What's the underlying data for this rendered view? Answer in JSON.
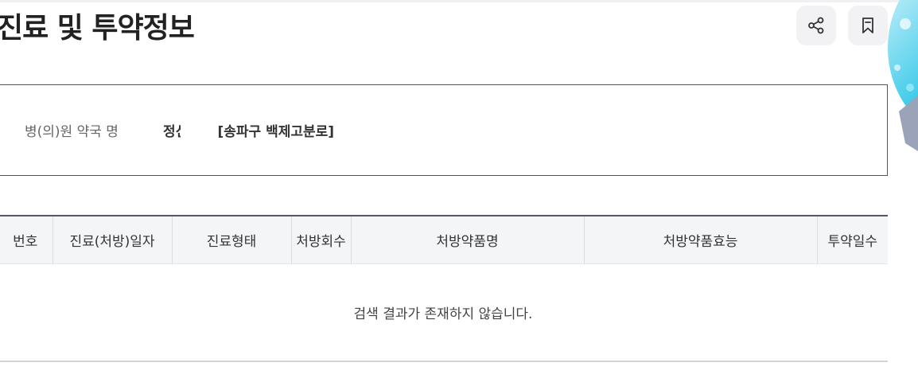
{
  "header": {
    "title": "진료 및 투약정보",
    "share_icon": "share-icon",
    "bookmark_icon": "bookmark-icon"
  },
  "pharmacy": {
    "label": "병(의)원 약국 명",
    "name": "정신약국 [송파구 백제고분로]"
  },
  "table": {
    "columns": [
      "번호",
      "진료(처방)일자",
      "진료형태",
      "처방회수",
      "처방약품명",
      "처방약품효능",
      "투약일수"
    ],
    "empty_message": "검색 결과가 존재하지 않습니다."
  },
  "colors": {
    "header_bg": "#f4f5f7",
    "table_top_border": "#555566",
    "icon_button_bg": "#f2f2f4"
  }
}
